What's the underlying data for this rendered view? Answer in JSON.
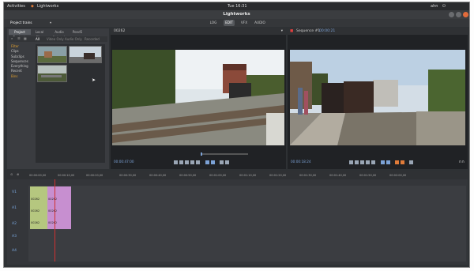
{
  "topbar": {
    "activities": "Activities",
    "app": "Lightworks",
    "clock": "Tue 16:31",
    "user": "ahn"
  },
  "title": "Lightworks",
  "tabs": [
    {
      "label": "LOG"
    },
    {
      "label": "EDIT"
    },
    {
      "label": "VFX"
    },
    {
      "label": "AUDIO"
    }
  ],
  "project": {
    "name": "Project trains"
  },
  "panel_tabs": [
    "Project Contents",
    "Local Files",
    "Audio Network",
    "Pond5"
  ],
  "panel_subtabs": [
    "All",
    "Video Only",
    "Audio Only",
    "Recorded"
  ],
  "tree": [
    "Filter",
    "Clips",
    "Subclips",
    "Sequences",
    "Everything",
    "Recent",
    "Bins"
  ],
  "source_viewer": {
    "title": "00262",
    "timecode": "00:00:47:00"
  },
  "record_viewer": {
    "title": "Sequence #1",
    "subtitle": "00:00:21",
    "timecode": "00:00:18:24"
  },
  "timeline": {
    "ruler": [
      "00:00:00,00",
      "00:00:10,00",
      "00:00:20,00",
      "00:00:30,00",
      "00:00:40,00",
      "00:00:50,00",
      "00:01:00,00",
      "00:01:10,00",
      "00:01:20,00",
      "00:01:30,00",
      "00:01:40,00",
      "00:01:50,00",
      "00:02:00,00"
    ],
    "tracks": [
      "V1",
      "A1",
      "A2",
      "A3",
      "A4"
    ],
    "clip_labels": [
      "00262",
      "00262",
      "00262",
      "00262",
      "00262",
      "00262"
    ]
  },
  "colors": {
    "accent": "#e07b39",
    "timecode": "#7ca2d6",
    "clip_green": "#b5c77f",
    "clip_purple": "#c78fd0"
  }
}
